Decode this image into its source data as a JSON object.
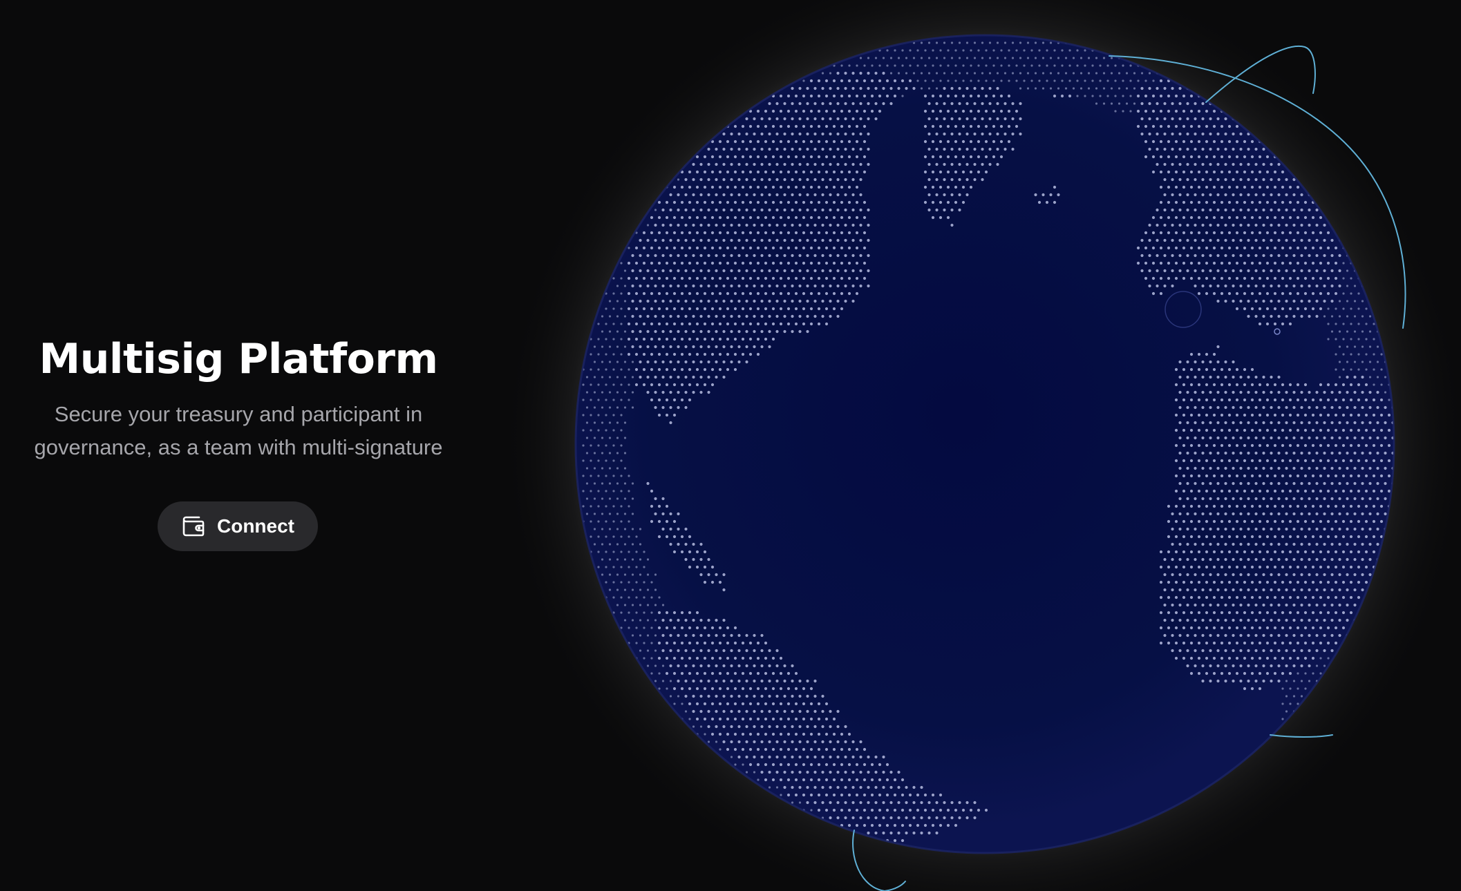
{
  "hero": {
    "title": "Multisig Platform",
    "subtitle_line1": "Secure your treasury and participant in",
    "subtitle_line2": "governance, as a team with multi-signature"
  },
  "connect_button": {
    "label": "Connect",
    "icon": "wallet-icon"
  },
  "globe": {
    "icon": "globe-illustration",
    "ocean_color": "#050a3d",
    "dot_color": "#b7bde0",
    "glow_color": "#e8e8e8",
    "arc_color": "#5fb0d6"
  },
  "colors": {
    "background": "#0a0a0b",
    "button_background": "#29292c",
    "subtitle_text": "#a6a6ab"
  }
}
